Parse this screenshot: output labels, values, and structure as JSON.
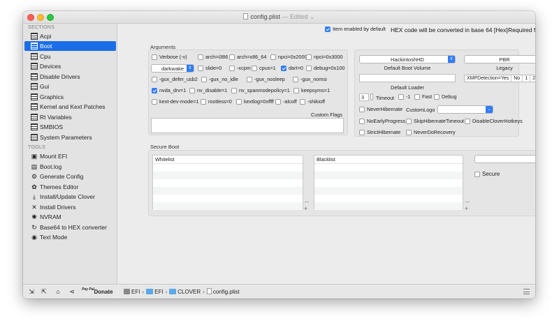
{
  "window": {
    "title": "config.plist",
    "edited": "— Edited ⌄"
  },
  "sidebar": {
    "sections_header": "SECTIONS",
    "sections": [
      "Acpi",
      "Boot",
      "Cpu",
      "Devices",
      "Disable Drivers",
      "Gui",
      "Graphics",
      "Kernel and Kext Patches",
      "Rt Variables",
      "SMBIOS",
      "System Parameters"
    ],
    "active_section": "Boot",
    "tools_header": "TOOLS",
    "tools": [
      {
        "label": "Mount EFI",
        "icon": "disk-icon"
      },
      {
        "label": "Boot.log",
        "icon": "document-icon"
      },
      {
        "label": "Generate Config",
        "icon": "gear-icon"
      },
      {
        "label": "Themes Editor",
        "icon": "palette-icon"
      },
      {
        "label": "Install/Update Clover",
        "icon": "download-icon"
      },
      {
        "label": "Install Drivers",
        "icon": "wrench-icon"
      },
      {
        "label": "NVRAM",
        "icon": "chip-icon"
      },
      {
        "label": "Base64 to HEX converter",
        "icon": "refresh-icon"
      },
      {
        "label": "Text Mode",
        "icon": "eye-icon"
      }
    ],
    "bottom": {
      "donate": "Donate",
      "pay_label": "Pay Pal"
    }
  },
  "header_bar": {
    "item_enabled": "Item enabled by default",
    "hex_note": "HEX code will be converted in base 64 [Hex]",
    "required": "Required field (*)"
  },
  "arguments": {
    "label": "Arguments",
    "rows": [
      [
        {
          "t": "Verbose (-v)",
          "on": false
        },
        {
          "t": "arch=i386",
          "on": false
        },
        {
          "t": "arch=x86_64",
          "on": false
        },
        {
          "t": "npci=0x2000",
          "on": false
        },
        {
          "t": "npci=0x3000",
          "on": false
        }
      ],
      [
        {
          "t": "slide=0",
          "on": false
        },
        {
          "t": "-xcpm",
          "on": false
        },
        {
          "t": "cpus=1",
          "on": false
        },
        {
          "t": "dart=0",
          "on": true
        },
        {
          "t": "debug=0x100",
          "on": false
        }
      ],
      [
        {
          "t": "-gux_defer_usb2",
          "on": false
        },
        {
          "t": "-gux_no_idle",
          "on": false
        },
        {
          "t": "-gux_nosleep",
          "on": false
        },
        {
          "t": "-gux_nomsi",
          "on": false
        }
      ],
      [
        {
          "t": "nvda_drv=1",
          "on": true
        },
        {
          "t": "nv_disable=1",
          "on": false
        },
        {
          "t": "nv_spanmodepolicy=1",
          "on": false
        },
        {
          "t": "keepsyms=1",
          "on": false
        }
      ],
      [
        {
          "t": "kext-dev-mode=1",
          "on": false
        },
        {
          "t": "rootless=0",
          "on": false
        },
        {
          "t": "kextlog=0xffff",
          "on": false
        },
        {
          "t": "-alcoff",
          "on": false
        },
        {
          "t": "-shikioff",
          "on": false
        }
      ]
    ],
    "darkwake": "darkwake",
    "custom_flags": "Custom Flags"
  },
  "boot_right": {
    "default_volume_value": "HackintoshHD",
    "default_volume_label": "Default Boot Volume",
    "legacy_value": "PBR",
    "legacy_label": "Legacy",
    "default_loader_label": "Default Loader",
    "xmp_label": "XMPDetection=Yes",
    "xmp_options": [
      "No",
      "1",
      "2"
    ],
    "timeout_value": "3",
    "timeout_label": "Timeout",
    "minus_one": "-1",
    "fast": "Fast",
    "debug": "Debug",
    "never_hibernate": "NeverHibernate",
    "custom_logo": "CustomLogo",
    "no_early_progress": "NoEarlyProgress",
    "skip_hibernate_timeout": "SkipHibernateTimeout",
    "disable_clover_hotkeys": "DisableCloverHotkeys",
    "strict_hibernate": "StrictHibernate",
    "never_do_recovery": "NeverDoRecovery"
  },
  "secure_boot": {
    "label": "Secure Boot",
    "whitelist": "Whitelist",
    "blacklist": "Blacklist",
    "secure": "Secure",
    "minus": "—",
    "plus": "+"
  },
  "path": [
    "EFI",
    "EFI",
    "CLOVER",
    "config.plist"
  ]
}
